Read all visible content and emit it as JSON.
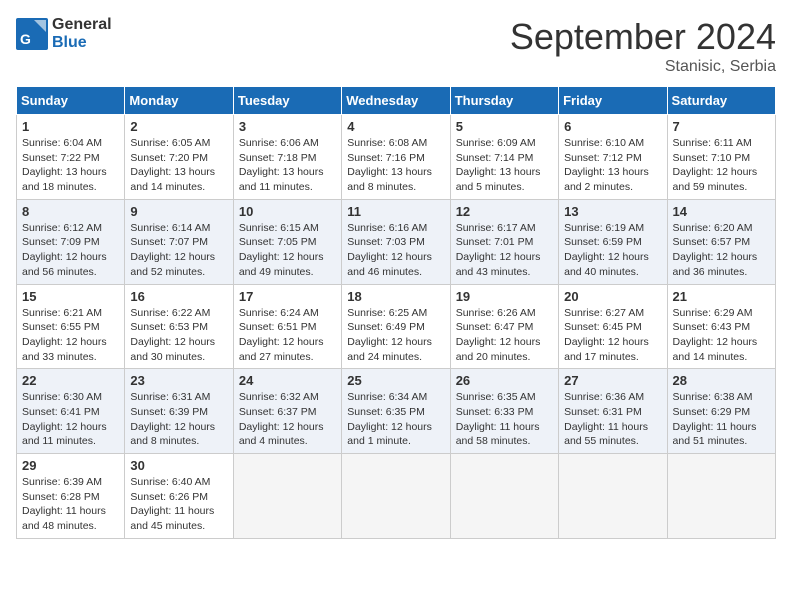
{
  "header": {
    "logo_general": "General",
    "logo_blue": "Blue",
    "month_title": "September 2024",
    "location": "Stanisic, Serbia"
  },
  "columns": [
    "Sunday",
    "Monday",
    "Tuesday",
    "Wednesday",
    "Thursday",
    "Friday",
    "Saturday"
  ],
  "rows": [
    [
      null,
      null,
      null,
      null,
      null,
      null,
      null
    ]
  ],
  "days": [
    {
      "date": 1,
      "col": 0,
      "sunrise": "6:04 AM",
      "sunset": "7:22 PM",
      "daylight": "13 hours and 18 minutes."
    },
    {
      "date": 2,
      "col": 1,
      "sunrise": "6:05 AM",
      "sunset": "7:20 PM",
      "daylight": "13 hours and 14 minutes."
    },
    {
      "date": 3,
      "col": 2,
      "sunrise": "6:06 AM",
      "sunset": "7:18 PM",
      "daylight": "13 hours and 11 minutes."
    },
    {
      "date": 4,
      "col": 3,
      "sunrise": "6:08 AM",
      "sunset": "7:16 PM",
      "daylight": "13 hours and 8 minutes."
    },
    {
      "date": 5,
      "col": 4,
      "sunrise": "6:09 AM",
      "sunset": "7:14 PM",
      "daylight": "13 hours and 5 minutes."
    },
    {
      "date": 6,
      "col": 5,
      "sunrise": "6:10 AM",
      "sunset": "7:12 PM",
      "daylight": "13 hours and 2 minutes."
    },
    {
      "date": 7,
      "col": 6,
      "sunrise": "6:11 AM",
      "sunset": "7:10 PM",
      "daylight": "12 hours and 59 minutes."
    },
    {
      "date": 8,
      "col": 0,
      "sunrise": "6:12 AM",
      "sunset": "7:09 PM",
      "daylight": "12 hours and 56 minutes."
    },
    {
      "date": 9,
      "col": 1,
      "sunrise": "6:14 AM",
      "sunset": "7:07 PM",
      "daylight": "12 hours and 52 minutes."
    },
    {
      "date": 10,
      "col": 2,
      "sunrise": "6:15 AM",
      "sunset": "7:05 PM",
      "daylight": "12 hours and 49 minutes."
    },
    {
      "date": 11,
      "col": 3,
      "sunrise": "6:16 AM",
      "sunset": "7:03 PM",
      "daylight": "12 hours and 46 minutes."
    },
    {
      "date": 12,
      "col": 4,
      "sunrise": "6:17 AM",
      "sunset": "7:01 PM",
      "daylight": "12 hours and 43 minutes."
    },
    {
      "date": 13,
      "col": 5,
      "sunrise": "6:19 AM",
      "sunset": "6:59 PM",
      "daylight": "12 hours and 40 minutes."
    },
    {
      "date": 14,
      "col": 6,
      "sunrise": "6:20 AM",
      "sunset": "6:57 PM",
      "daylight": "12 hours and 36 minutes."
    },
    {
      "date": 15,
      "col": 0,
      "sunrise": "6:21 AM",
      "sunset": "6:55 PM",
      "daylight": "12 hours and 33 minutes."
    },
    {
      "date": 16,
      "col": 1,
      "sunrise": "6:22 AM",
      "sunset": "6:53 PM",
      "daylight": "12 hours and 30 minutes."
    },
    {
      "date": 17,
      "col": 2,
      "sunrise": "6:24 AM",
      "sunset": "6:51 PM",
      "daylight": "12 hours and 27 minutes."
    },
    {
      "date": 18,
      "col": 3,
      "sunrise": "6:25 AM",
      "sunset": "6:49 PM",
      "daylight": "12 hours and 24 minutes."
    },
    {
      "date": 19,
      "col": 4,
      "sunrise": "6:26 AM",
      "sunset": "6:47 PM",
      "daylight": "12 hours and 20 minutes."
    },
    {
      "date": 20,
      "col": 5,
      "sunrise": "6:27 AM",
      "sunset": "6:45 PM",
      "daylight": "12 hours and 17 minutes."
    },
    {
      "date": 21,
      "col": 6,
      "sunrise": "6:29 AM",
      "sunset": "6:43 PM",
      "daylight": "12 hours and 14 minutes."
    },
    {
      "date": 22,
      "col": 0,
      "sunrise": "6:30 AM",
      "sunset": "6:41 PM",
      "daylight": "12 hours and 11 minutes."
    },
    {
      "date": 23,
      "col": 1,
      "sunrise": "6:31 AM",
      "sunset": "6:39 PM",
      "daylight": "12 hours and 8 minutes."
    },
    {
      "date": 24,
      "col": 2,
      "sunrise": "6:32 AM",
      "sunset": "6:37 PM",
      "daylight": "12 hours and 4 minutes."
    },
    {
      "date": 25,
      "col": 3,
      "sunrise": "6:34 AM",
      "sunset": "6:35 PM",
      "daylight": "12 hours and 1 minute."
    },
    {
      "date": 26,
      "col": 4,
      "sunrise": "6:35 AM",
      "sunset": "6:33 PM",
      "daylight": "11 hours and 58 minutes."
    },
    {
      "date": 27,
      "col": 5,
      "sunrise": "6:36 AM",
      "sunset": "6:31 PM",
      "daylight": "11 hours and 55 minutes."
    },
    {
      "date": 28,
      "col": 6,
      "sunrise": "6:38 AM",
      "sunset": "6:29 PM",
      "daylight": "11 hours and 51 minutes."
    },
    {
      "date": 29,
      "col": 0,
      "sunrise": "6:39 AM",
      "sunset": "6:28 PM",
      "daylight": "11 hours and 48 minutes."
    },
    {
      "date": 30,
      "col": 1,
      "sunrise": "6:40 AM",
      "sunset": "6:26 PM",
      "daylight": "11 hours and 45 minutes."
    }
  ]
}
